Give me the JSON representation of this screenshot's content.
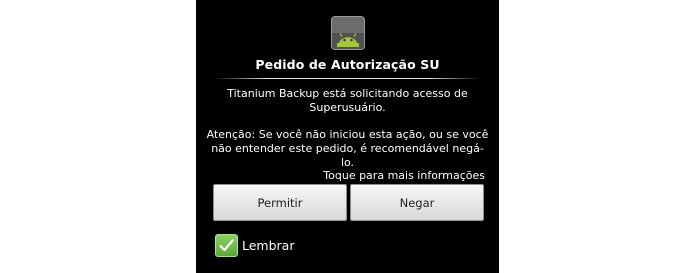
{
  "dialog": {
    "app_icon": "android-robot-icon",
    "title": "Pedido de Autorização SU",
    "message_line1": "Titanium Backup está solicitando acesso de",
    "message_line2": "Superusuário.",
    "warning_line1": "Atenção: Se você não iniciou esta ação, ou se você",
    "warning_line2": "não entender este pedido, é recomendável negá-lo.",
    "more_info": "Toque para mais informações",
    "allow_label": "Permitir",
    "deny_label": "Negar",
    "remember_label": "Lembrar",
    "remember_checked": true,
    "checkbox_icon": "checkmark-icon"
  },
  "colors": {
    "background": "#000000",
    "text": "#ffffff",
    "button_text": "#222222",
    "checkbox_green": "#6ab844",
    "icon_green": "#9ccb3b"
  }
}
